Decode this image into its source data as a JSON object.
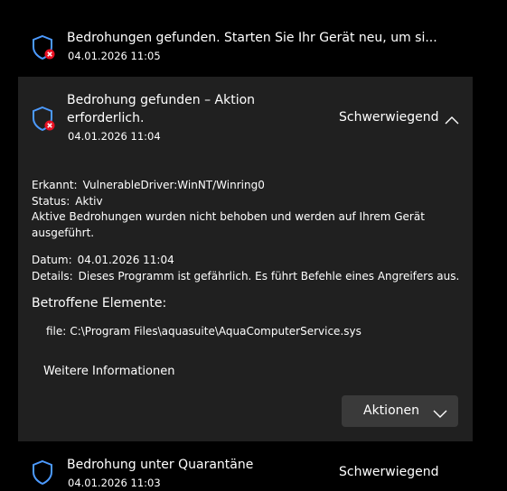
{
  "threats": [
    {
      "title": "Bedrohungen gefunden. Starten Sie Ihr Gerät neu, um si...",
      "time": "04.01.2026 11:05"
    },
    {
      "title_line1": "Bedrohung gefunden – Aktion",
      "title_line2": "erforderlich.",
      "time": "04.01.2026 11:04",
      "severity": "Schwerwiegend",
      "details": {
        "detected_label": "Erkannt:",
        "detected_value": "VulnerableDriver:WinNT/Winring0",
        "status_label": "Status:",
        "status_value": "Aktiv",
        "status_desc_line1": "Aktive Bedrohungen wurden nicht behoben und werden auf Ihrem Gerät",
        "status_desc_line2": "ausgeführt.",
        "date_label": "Datum:",
        "date_value": "04.01.2026 11:04",
        "details_label": "Details:",
        "details_value": "Dieses Programm ist gefährlich. Es führt Befehle eines Angreifers aus.",
        "affected_heading": "Betroffene Elemente:",
        "file_label": "file:",
        "file_path": "C:\\Program Files\\aquasuite\\AquaComputerService.sys",
        "more_info": "Weitere Informationen",
        "actions_label": "Aktionen"
      }
    },
    {
      "title": "Bedrohung unter Quarantäne",
      "time": "04.01.2026 11:03",
      "severity": "Schwerwiegend"
    }
  ],
  "colors": {
    "shield_blue": "#4c9aff",
    "alert_red": "#e81123",
    "card_bg": "#202020",
    "button_bg": "#3a3a3a"
  },
  "icons": [
    "shield-alert-icon",
    "shield-alert-icon",
    "chevron-up-icon",
    "chevron-down-icon",
    "shield-icon"
  ]
}
